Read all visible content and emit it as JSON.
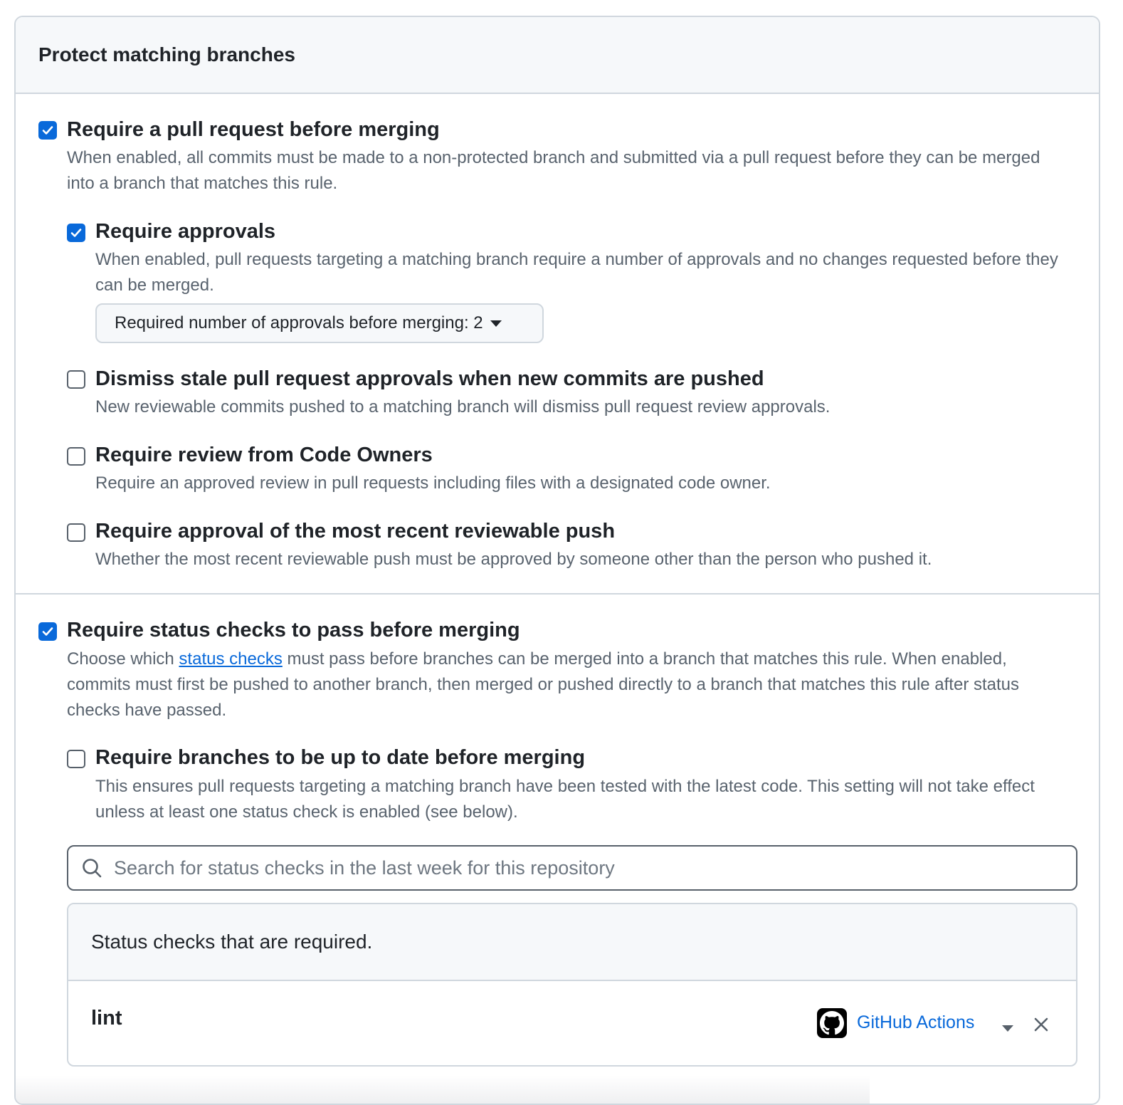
{
  "panel": {
    "title": "Protect matching branches"
  },
  "options": {
    "require_pr": {
      "checked": true,
      "title": "Require a pull request before merging",
      "desc": "When enabled, all commits must be made to a non-protected branch and submitted via a pull request before they can be merged into a branch that matches this rule."
    },
    "require_approvals": {
      "checked": true,
      "title": "Require approvals",
      "desc": "When enabled, pull requests targeting a matching branch require a number of approvals and no changes requested before they can be merged.",
      "dropdown_label": "Required number of approvals before merging: 2"
    },
    "dismiss_stale": {
      "checked": false,
      "title": "Dismiss stale pull request approvals when new commits are pushed",
      "desc": "New reviewable commits pushed to a matching branch will dismiss pull request review approvals."
    },
    "code_owners": {
      "checked": false,
      "title": "Require review from Code Owners",
      "desc": "Require an approved review in pull requests including files with a designated code owner."
    },
    "recent_push": {
      "checked": false,
      "title": "Require approval of the most recent reviewable push",
      "desc": "Whether the most recent reviewable push must be approved by someone other than the person who pushed it."
    },
    "status_checks": {
      "checked": true,
      "title": "Require status checks to pass before merging",
      "desc_before": "Choose which ",
      "desc_link": "status checks",
      "desc_after": " must pass before branches can be merged into a branch that matches this rule. When enabled, commits must first be pushed to another branch, then merged or pushed directly to a branch that matches this rule after status checks have passed."
    },
    "up_to_date": {
      "checked": false,
      "title": "Require branches to be up to date before merging",
      "desc": "This ensures pull requests targeting a matching branch have been tested with the latest code. This setting will not take effect unless at least one status check is enabled (see below)."
    }
  },
  "search": {
    "placeholder": "Search for status checks in the last week for this repository",
    "icon": "search-icon"
  },
  "required_checks": {
    "header": "Status checks that are required.",
    "rows": [
      {
        "name": "lint",
        "app": "GitHub Actions",
        "icon": "github-icon"
      }
    ]
  },
  "colors": {
    "accent": "#0969da",
    "border": "#d0d7de",
    "muted_text": "#59636e"
  }
}
